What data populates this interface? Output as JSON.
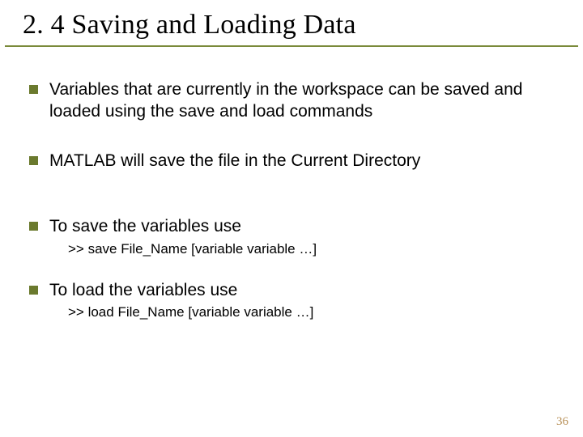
{
  "title": "2. 4 Saving and Loading Data",
  "bullets": {
    "b0": "Variables that are currently in the workspace can be saved and loaded using the save and load commands",
    "b1": "MATLAB will save the file in the Current Directory",
    "b2": "To save the variables use",
    "code2": ">> save File_Name [variable variable …]",
    "b3": "To load the variables use",
    "code3": ">> load File_Name [variable variable …]"
  },
  "page_number": "36"
}
